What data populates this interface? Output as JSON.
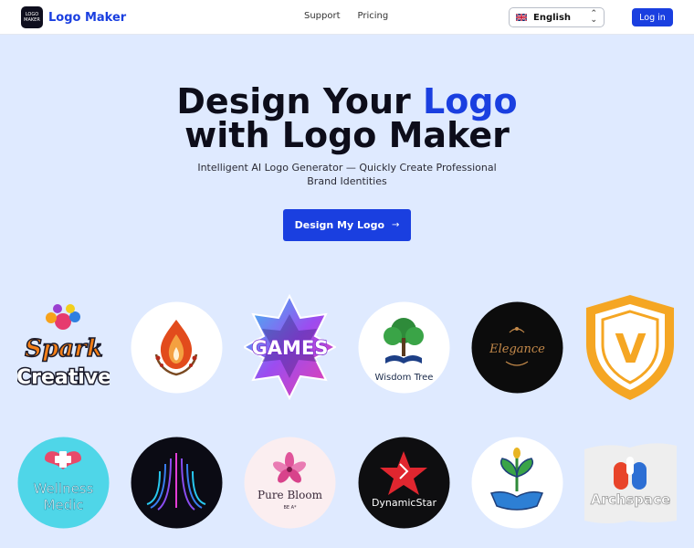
{
  "header": {
    "brand": "Logo Maker",
    "brand_mark_text": "LOGO MAKER",
    "nav": [
      "Support",
      "Pricing"
    ],
    "language": "English",
    "login": "Log in"
  },
  "hero": {
    "title_part1": "Design Your ",
    "title_accent": "Logo",
    "title_line2": "with Logo Maker",
    "subtitle": "Intelligent AI Logo Generator — Quickly Create Professional Brand Identities",
    "cta": "Design My Logo",
    "cta_arrow": "→"
  },
  "gallery": {
    "row1": [
      {
        "icon": "spark-creative-logo",
        "text1": "Spark",
        "text2": "Creative"
      },
      {
        "icon": "flame-leaves-logo"
      },
      {
        "icon": "games-logo",
        "text1": "GAMES"
      },
      {
        "icon": "wisdom-tree-logo",
        "text1": "Wisdom Tree"
      },
      {
        "icon": "elegance-logo",
        "text1": "Elegance"
      },
      {
        "icon": "v-shield-logo",
        "text1": "V"
      }
    ],
    "row2": [
      {
        "icon": "wellness-medic-logo",
        "text1": "Wellness",
        "text2": "Medic"
      },
      {
        "icon": "neon-waves-logo"
      },
      {
        "icon": "pure-bloom-logo",
        "text1": "Pure Bloom",
        "text2": "BE A*"
      },
      {
        "icon": "dynamic-star-logo",
        "text1": "DynamicStar"
      },
      {
        "icon": "hand-plant-logo"
      },
      {
        "icon": "archspace-logo",
        "text1": "Archspace"
      }
    ]
  },
  "colors": {
    "brand_blue": "#1a3fe0",
    "hero_bg": "#dfeaff",
    "title_dark": "#0d0d1a"
  }
}
